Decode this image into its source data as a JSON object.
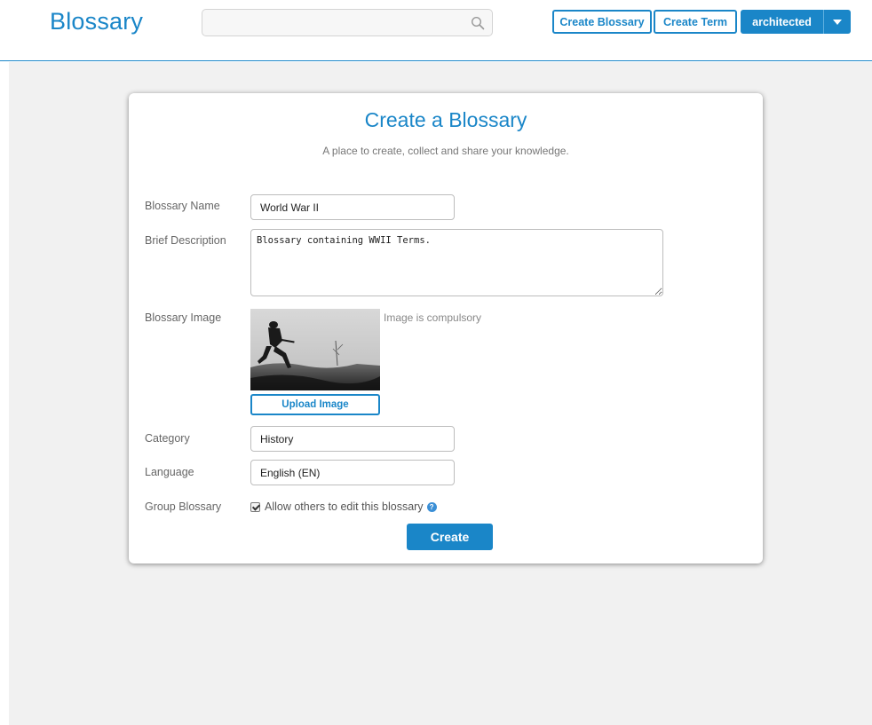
{
  "header": {
    "logo": "Blossary",
    "search_placeholder": "",
    "create_blossary_label": "Create Blossary",
    "create_term_label": "Create Term",
    "username": "architected"
  },
  "form": {
    "title": "Create a Blossary",
    "subtitle": "A place to create, collect and share your knowledge.",
    "name_label": "Blossary Name",
    "name_value": "World War II",
    "description_label": "Brief Description",
    "description_value": "Blossary containing WWII Terms.",
    "image_label": "Blossary Image",
    "image_note": "Image is compulsory",
    "upload_label": "Upload Image",
    "category_label": "Category",
    "category_value": "History",
    "language_label": "Language",
    "language_value": "English (EN)",
    "group_label": "Group Blossary",
    "group_checkbox_label": "Allow others to edit this blossary",
    "group_checked": true,
    "create_label": "Create"
  },
  "colors": {
    "accent": "#1a86c8",
    "background": "#f1f1f1"
  }
}
